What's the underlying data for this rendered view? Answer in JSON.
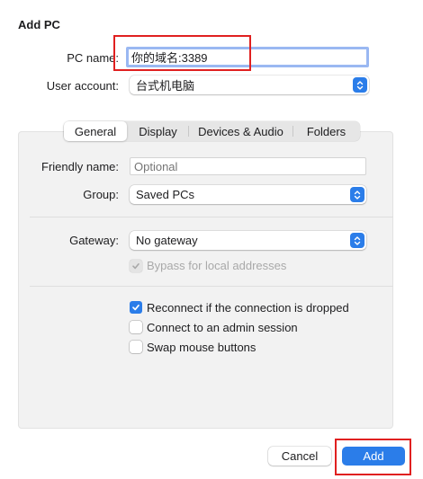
{
  "dialog": {
    "title": "Add PC",
    "pc_name_label": "PC name:",
    "pc_name_value": "你的域名:3389",
    "user_account_label": "User account:",
    "user_account_value": "台式机电脑"
  },
  "tabs": [
    "General",
    "Display",
    "Devices & Audio",
    "Folders"
  ],
  "general": {
    "friendly_name_label": "Friendly name:",
    "friendly_name_placeholder": "Optional",
    "group_label": "Group:",
    "group_value": "Saved PCs",
    "gateway_label": "Gateway:",
    "gateway_value": "No gateway",
    "bypass_label": "Bypass for local addresses",
    "reconnect_label": "Reconnect if the connection is dropped",
    "admin_label": "Connect to an admin session",
    "swap_label": "Swap mouse buttons"
  },
  "buttons": {
    "cancel": "Cancel",
    "add": "Add"
  },
  "colors": {
    "accent": "#2b7de9",
    "highlight": "#e02020"
  },
  "icons": {
    "stepper": "chevron-updown-icon",
    "check": "checkmark-icon"
  }
}
